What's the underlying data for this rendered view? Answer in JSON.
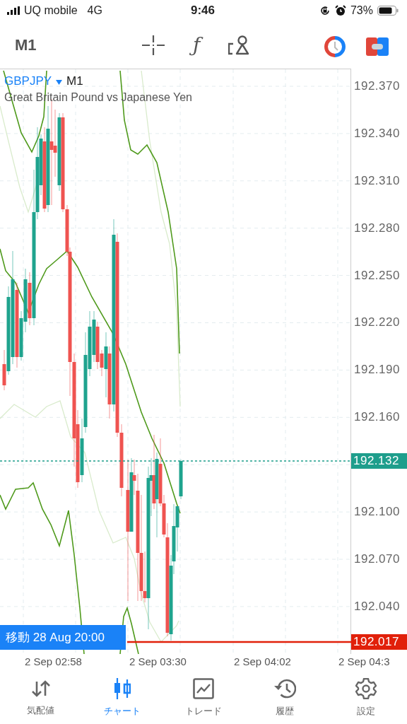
{
  "status_bar": {
    "carrier": "UQ mobile",
    "network": "4G",
    "time": "9:46",
    "battery": "73%"
  },
  "toolbar": {
    "timeframe": "M1",
    "indicators_glyph": "ƒ"
  },
  "chart": {
    "symbol": "GBPJPY",
    "timeframe": "M1",
    "description": "Great Britain Pound vs Japanese Yen",
    "price_ticks": [
      "192.370",
      "192.340",
      "192.310",
      "192.280",
      "192.250",
      "192.220",
      "192.190",
      "192.160",
      "192.100",
      "192.070",
      "192.040"
    ],
    "price_markers": [
      {
        "kind": "bid",
        "label": "192.132"
      },
      {
        "kind": "line",
        "label": "192.017"
      }
    ],
    "navigation_label": "移動 28 Aug 20:00",
    "time_ticks": [
      "2 Sep 02:58",
      "2 Sep 03:30",
      "2 Sep 04:02",
      "2 Sep 04:3"
    ]
  },
  "tabs": [
    {
      "label": "気配値",
      "selected": false
    },
    {
      "label": "チャート",
      "selected": true
    },
    {
      "label": "トレード",
      "selected": false
    },
    {
      "label": "履歴",
      "selected": false
    },
    {
      "label": "設定",
      "selected": false
    }
  ]
}
